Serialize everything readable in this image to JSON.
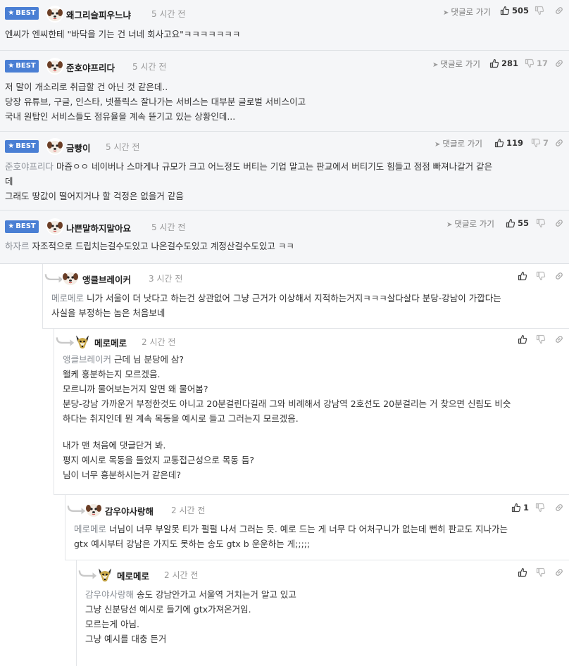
{
  "best_label": "BEST",
  "reply_link_label": "댓글로 가기",
  "comments": [
    {
      "user": "왜그리슬피우느냐",
      "time": "5 시간 전",
      "up": "505",
      "down": "",
      "lines": [
        "엔씨가 엔씨한테 \"바닥을 기는 건 너네 회사고요\"ㅋㅋㅋㅋㅋㅋㅋ"
      ]
    },
    {
      "user": "준호야프리다",
      "time": "5 시간 전",
      "up": "281",
      "down": "17",
      "lines": [
        "저 말이 개소리로 취급할 건 아닌 것 같은데..",
        "당장 유튜브, 구글, 인스타, 넷플릭스 잘나가는 서비스는 대부분 글로벌 서비스이고",
        "국내 원탑인 서비스들도 점유율을 계속 뜯기고 있는 상황인데..."
      ]
    },
    {
      "user": "금빵이",
      "time": "5 시간 전",
      "up": "119",
      "down": "7",
      "mention": "준호야프리다",
      "lines": [
        "마즘ㅇㅇ 네이버나 스마게나 규모가 크고 어느정도 버티는 기업 말고는 판교에서 버티기도 힘들고 점점 빠져나갈거 같은",
        "데",
        "그래도 땅값이 떨어지거나 할 걱정은 없을거 같음"
      ]
    },
    {
      "user": "나쁜말하지말아요",
      "time": "5 시간 전",
      "up": "55",
      "down": "",
      "mention": "하자르",
      "lines": [
        "자조적으로 드립치는걸수도있고 나온걸수도있고 계정산걸수도있고 ㅋㅋ"
      ]
    }
  ],
  "replies": [
    {
      "user": "앵클브레이커",
      "time": "3 시간 전",
      "up": "",
      "mention": "메로메로",
      "lines": [
        "니가 서울이 더 낫다고 하는건 상관없어 그냥 근거가 이상해서 지적하는거지ㅋㅋㅋ살다살다 분당-강남이 가깝다는",
        "사실을 부정하는 놈은 처음보네"
      ]
    },
    {
      "user": "메로메로",
      "time": "2 시간 전",
      "up": "",
      "mention": "앵클브레이커",
      "lines": [
        "근데 님 분당에 삼?",
        "왤케 흥분하는지 모르겠음.",
        "모르니까 물어보는거지 알면 왜 물어봄?",
        "분당-강남 가까운거 부정한것도 아니고 20분걸린다길래 그와 비례해서 강남역 2호선도 20분걸리는 거 찾으면 신림도 비슷",
        "하다는 취지인데 뭔 계속 목동을 예시로 들고 그러는지 모르겠음.",
        "",
        "내가 맨 처음에 댓글단거 봐.",
        "평지 예시로 목동을 들었지 교통접근성으로 목동 듬?",
        "님이 너무 흥분하시는거 같은데?"
      ]
    },
    {
      "user": "감우야사랑해",
      "time": "2 시간 전",
      "up": "1",
      "mention": "메로메로",
      "lines": [
        "너님이 너무 부알못 티가 펄펄 나서 그러는 듯. 예로 드는 게 너무 다 어처구니가 없는데 뻔히 판교도 지나가는",
        "gtx 예시부터 강남은 가지도 못하는 송도 gtx b 운운하는 게;;;;;"
      ]
    },
    {
      "user": "메로메로",
      "time": "2 시간 전",
      "up": "",
      "mention": "감우야사랑해",
      "lines": [
        "송도 강남안가고 서울역 거치는거 알고 있고",
        "그냥 신분당선 예시로 들기에 gtx가져온거임.",
        "모르는게 아님.",
        "그냥 예시를 대충 든거"
      ]
    }
  ]
}
